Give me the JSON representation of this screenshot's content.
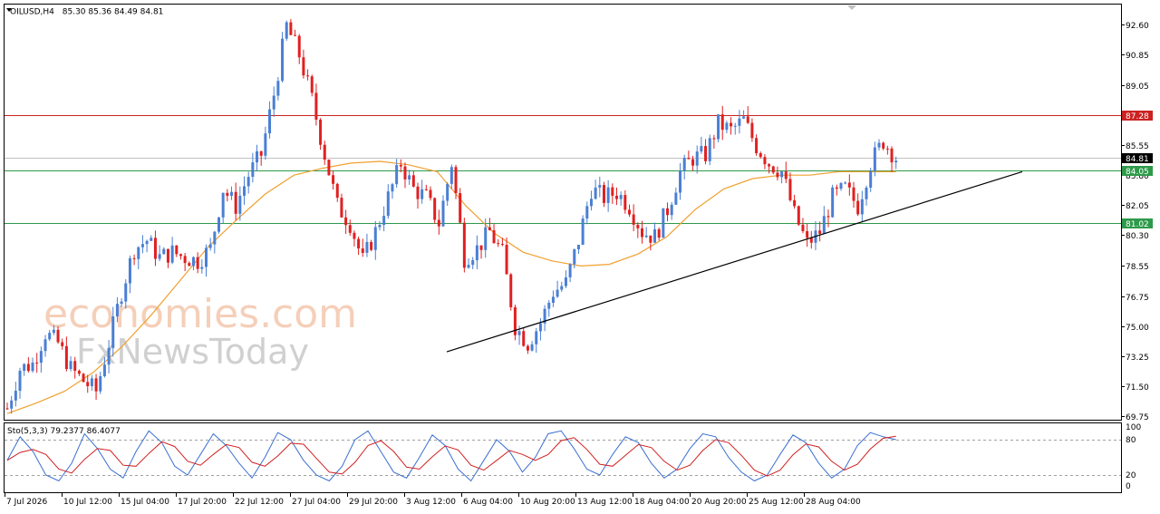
{
  "header": {
    "symbol": "OILUSD,H4",
    "ohlc": "85.30 85.36 84.49 84.81"
  },
  "indicator": {
    "label": "Sto(5,3,3) 79.2377 86.4077"
  },
  "watermark": {
    "line1": "economies.com",
    "line2": "FxNewsToday"
  },
  "colors": {
    "bull": "#4a7fd4",
    "bear": "#e02020",
    "ma": "#f0a030",
    "resistance": "#cc2222",
    "support": "#2e9a4a",
    "trend": "#000000",
    "sto_main": "#3a6fd0",
    "sto_signal": "#d02020",
    "price_tag": "#000000"
  },
  "chart_data": {
    "type": "candlestick",
    "ylim": [
      69.75,
      93.5
    ],
    "yticks": [
      "92.60",
      "90.85",
      "89.05",
      "87.30",
      "85.55",
      "83.80",
      "82.05",
      "80.30",
      "78.55",
      "76.75",
      "75.00",
      "73.25",
      "71.50",
      "69.75"
    ],
    "xticks": [
      "7 Jul 2026",
      "10 Jul 12:00",
      "15 Jul 04:00",
      "17 Jul 20:00",
      "22 Jul 12:00",
      "27 Jul 04:00",
      "29 Jul 20:00",
      "3 Aug 12:00",
      "6 Aug 04:00",
      "10 Aug 20:00",
      "13 Aug 12:00",
      "18 Aug 04:00",
      "20 Aug 20:00",
      "25 Aug 12:00",
      "28 Aug 04:00"
    ],
    "current_price": "84.81",
    "horizontal_levels": [
      {
        "value": 87.28,
        "label": "87.28",
        "kind": "resistance"
      },
      {
        "value": 84.05,
        "label": "84.05",
        "kind": "support"
      },
      {
        "value": 81.02,
        "label": "81.02",
        "kind": "support"
      }
    ],
    "trendline": {
      "from": {
        "x": "3 Aug 12:00",
        "y": 73.5
      },
      "to": {
        "x": "1 Sep 16:00",
        "y": 84.0
      }
    },
    "price_path": [
      70.2,
      72.5,
      72.8,
      74.6,
      74.0,
      72.5,
      71.8,
      71.2,
      74.0,
      77.0,
      79.5,
      80.0,
      79.0,
      79.3,
      79.0,
      78.8,
      79.5,
      83.0,
      82.0,
      83.8,
      85.0,
      88.5,
      92.5,
      90.8,
      88.2,
      85.0,
      82.0,
      81.0,
      78.8,
      80.5,
      82.5,
      84.5,
      83.0,
      82.5,
      81.0,
      84.5,
      79.0,
      79.5,
      80.5,
      79.2,
      75.0,
      74.0,
      75.2,
      77.0,
      77.5,
      80.0,
      83.0,
      82.5,
      82.8,
      82.0,
      80.5,
      80.2,
      81.8,
      84.0,
      84.8,
      85.0,
      86.8,
      86.4,
      87.0,
      85.5,
      84.5,
      84.0,
      81.5,
      79.8,
      80.5,
      82.5,
      83.0,
      82.0,
      84.5,
      85.8,
      84.81
    ],
    "moving_average": [
      69.9,
      70.5,
      71.2,
      72.3,
      73.8,
      75.6,
      77.6,
      79.6,
      81.2,
      82.7,
      83.8,
      84.2,
      84.5,
      84.6,
      84.4,
      84.0,
      82.0,
      80.4,
      79.3,
      78.8,
      78.5,
      78.6,
      79.2,
      80.2,
      81.8,
      83.0,
      83.6,
      83.8,
      83.8,
      84.0,
      84.0,
      84.0
    ],
    "stochastic": {
      "label": "Sto(5,3,3)",
      "main": 79.2377,
      "signal": 86.4077,
      "ylim": [
        0,
        100
      ],
      "levels": [
        80,
        20
      ],
      "tick_labels": [
        "100",
        "80",
        "20",
        "0"
      ],
      "main_path": [
        45,
        85,
        60,
        20,
        10,
        40,
        90,
        65,
        30,
        15,
        60,
        95,
        75,
        35,
        20,
        55,
        90,
        70,
        40,
        15,
        50,
        92,
        80,
        45,
        20,
        10,
        35,
        80,
        95,
        60,
        25,
        15,
        50,
        88,
        70,
        30,
        10,
        45,
        80,
        60,
        25,
        50,
        90,
        95,
        65,
        30,
        20,
        55,
        85,
        75,
        40,
        15,
        30,
        65,
        90,
        85,
        50,
        25,
        10,
        20,
        55,
        88,
        75,
        40,
        15,
        30,
        70,
        92,
        85,
        80
      ]
    }
  }
}
